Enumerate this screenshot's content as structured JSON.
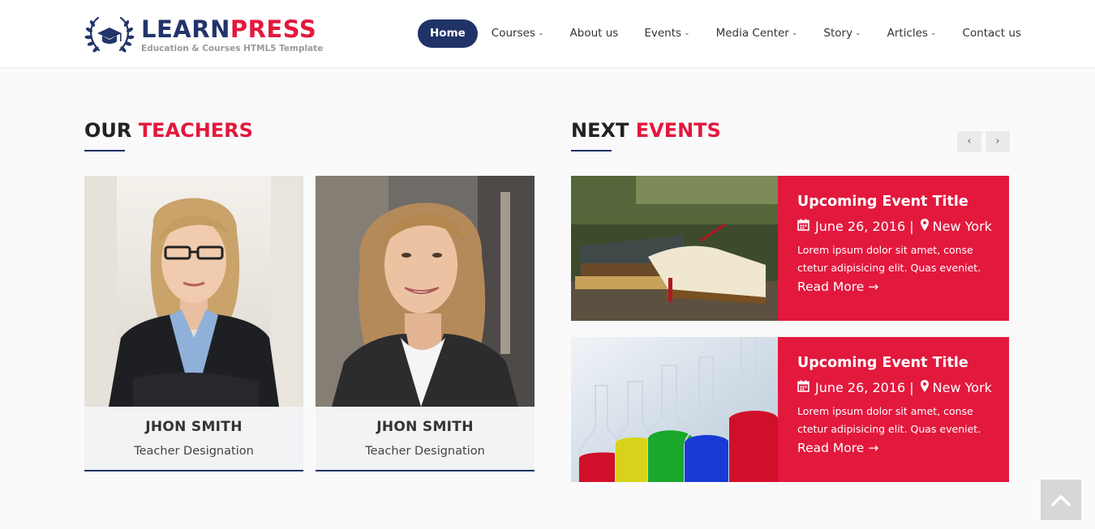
{
  "brand": {
    "name_part1": "LEARN",
    "name_part2": "PRESS",
    "tagline": "Education & Courses HTML5 Template"
  },
  "nav": {
    "items": [
      {
        "label": "Home",
        "active": true,
        "dropdown": false
      },
      {
        "label": "Courses",
        "active": false,
        "dropdown": true
      },
      {
        "label": "About us",
        "active": false,
        "dropdown": false
      },
      {
        "label": "Events",
        "active": false,
        "dropdown": true
      },
      {
        "label": "Media Center",
        "active": false,
        "dropdown": true
      },
      {
        "label": "Story",
        "active": false,
        "dropdown": true
      },
      {
        "label": "Articles",
        "active": false,
        "dropdown": true
      },
      {
        "label": "Contact us",
        "active": false,
        "dropdown": false
      }
    ]
  },
  "teachers_section": {
    "title_part1": "OUR",
    "title_part2": "TEACHERS",
    "teachers": [
      {
        "name": "JHON SMITH",
        "designation": "Teacher Designation"
      },
      {
        "name": "JHON SMITH",
        "designation": "Teacher Designation"
      }
    ]
  },
  "events_section": {
    "title_part1": "NEXT",
    "title_part2": "EVENTS",
    "prev_icon": "chevron-left-icon",
    "next_icon": "chevron-right-icon",
    "events": [
      {
        "title": "Upcoming Event Title",
        "date": "June 26, 2016 |",
        "location": "New York",
        "description": "Lorem ipsum dolor sit amet, conse ctetur adipisicing elit. Quas eveniet.",
        "read_more": "Read More →"
      },
      {
        "title": "Upcoming Event Title",
        "date": "June 26, 2016 |",
        "location": "New York",
        "description": "Lorem ipsum dolor sit amet, conse ctetur adipisicing elit. Quas eveniet.",
        "read_more": "Read More →"
      }
    ]
  },
  "colors": {
    "primary_navy": "#1f3368",
    "accent_red": "#e3183d",
    "page_bg": "#fafafa"
  },
  "back_to_top_icon": "chevron-up-icon"
}
